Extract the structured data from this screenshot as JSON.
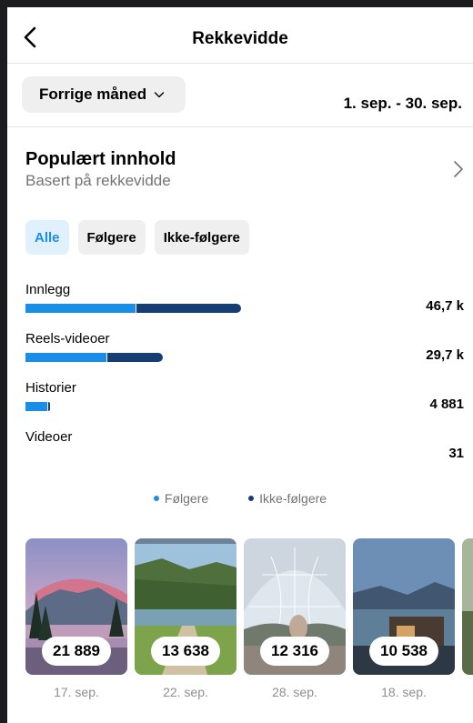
{
  "header": {
    "title": "Rekkevidde"
  },
  "period": {
    "label": "Forrige måned",
    "date_range": "1. sep. - 30. sep."
  },
  "popular": {
    "title": "Populært innhold",
    "subtitle": "Basert på rekkevidde"
  },
  "filters": [
    "Alle",
    "Følgere",
    "Ikke-følgere"
  ],
  "metrics": [
    {
      "label": "Innlegg",
      "value": "46,7 k",
      "followers_share": 0.51
    },
    {
      "label": "Reels-videoer",
      "value": "29,7 k",
      "followers_share": 0.59
    },
    {
      "label": "Historier",
      "value": "4 881",
      "followers_share": 0.88
    },
    {
      "label": "Videoer",
      "value": "31",
      "followers_share": 1.0
    }
  ],
  "legend": {
    "followers": "Følgere",
    "non_followers": "Ikke-følgere"
  },
  "colors": {
    "followers": "#1a8de6",
    "non_followers": "#173e73",
    "active_chip_text": "#1a8de6"
  },
  "thumbnails": [
    {
      "count": "21 889",
      "date": "17. sep."
    },
    {
      "count": "13 638",
      "date": "22. sep."
    },
    {
      "count": "12 316",
      "date": "28. sep."
    },
    {
      "count": "10 538",
      "date": "18. sep."
    }
  ]
}
